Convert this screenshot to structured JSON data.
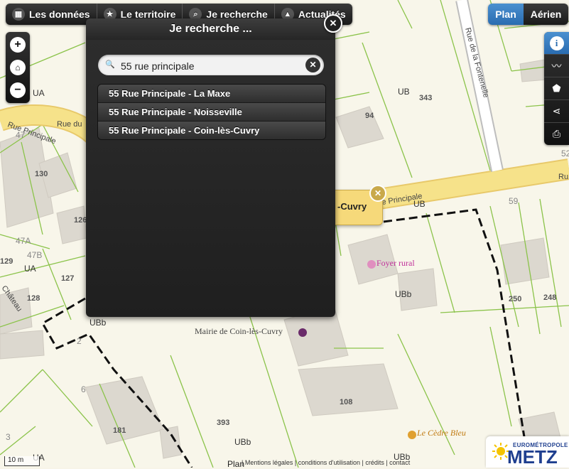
{
  "nav": {
    "items": [
      {
        "label": "Les données",
        "icon": "grid-icon"
      },
      {
        "label": "Le territoire",
        "icon": "star-icon"
      },
      {
        "label": "Je recherche",
        "icon": "search-icon"
      },
      {
        "label": "Actualités",
        "icon": "warning-icon"
      }
    ]
  },
  "view_toggle": {
    "plan": "Plan",
    "aerien": "Aérien",
    "active": "Plan"
  },
  "search_panel": {
    "title": "Je recherche ...",
    "input_value": "55 rue principale",
    "results": [
      "55 Rue Principale - La Maxe",
      "55 Rue Principale - Noisseville",
      "55 Rue Principale - Coin-lès-Cuvry"
    ]
  },
  "callout": {
    "text": "-Cuvry"
  },
  "map": {
    "street_labels": [
      "Rue Principale",
      "Rue du",
      "Rue de la Fontenelle",
      "e Principale",
      "Ru",
      "Château"
    ],
    "zone_labels": [
      "UA",
      "UB",
      "UB",
      "UBb",
      "UBb",
      "UA",
      "UBb",
      "UBb",
      "UA"
    ],
    "parcel_numbers": [
      "47",
      "130",
      "126",
      "47A",
      "47B",
      "129",
      "127",
      "128",
      "94",
      "343",
      "59",
      "250",
      "248",
      "108",
      "393",
      "181",
      "6",
      "3",
      "2",
      "52"
    ],
    "pois": [
      "Foyer rural",
      "Mairie de Coin-lès-Cuvry",
      "Le Cèdre Bleu"
    ]
  },
  "footer": {
    "plan_label": "Plan",
    "links": "| Mentions légales | conditions d'utilisation | crédits | contact",
    "scale": "10 m"
  },
  "logo": {
    "top": "EUROMÉTROPOLE",
    "main": "METZ"
  },
  "colors": {
    "road": "#f6e28a",
    "parcel_line": "#8bc34a",
    "accent": "#2a6cb0",
    "panel": "#262626",
    "poi": "#c0309a"
  }
}
